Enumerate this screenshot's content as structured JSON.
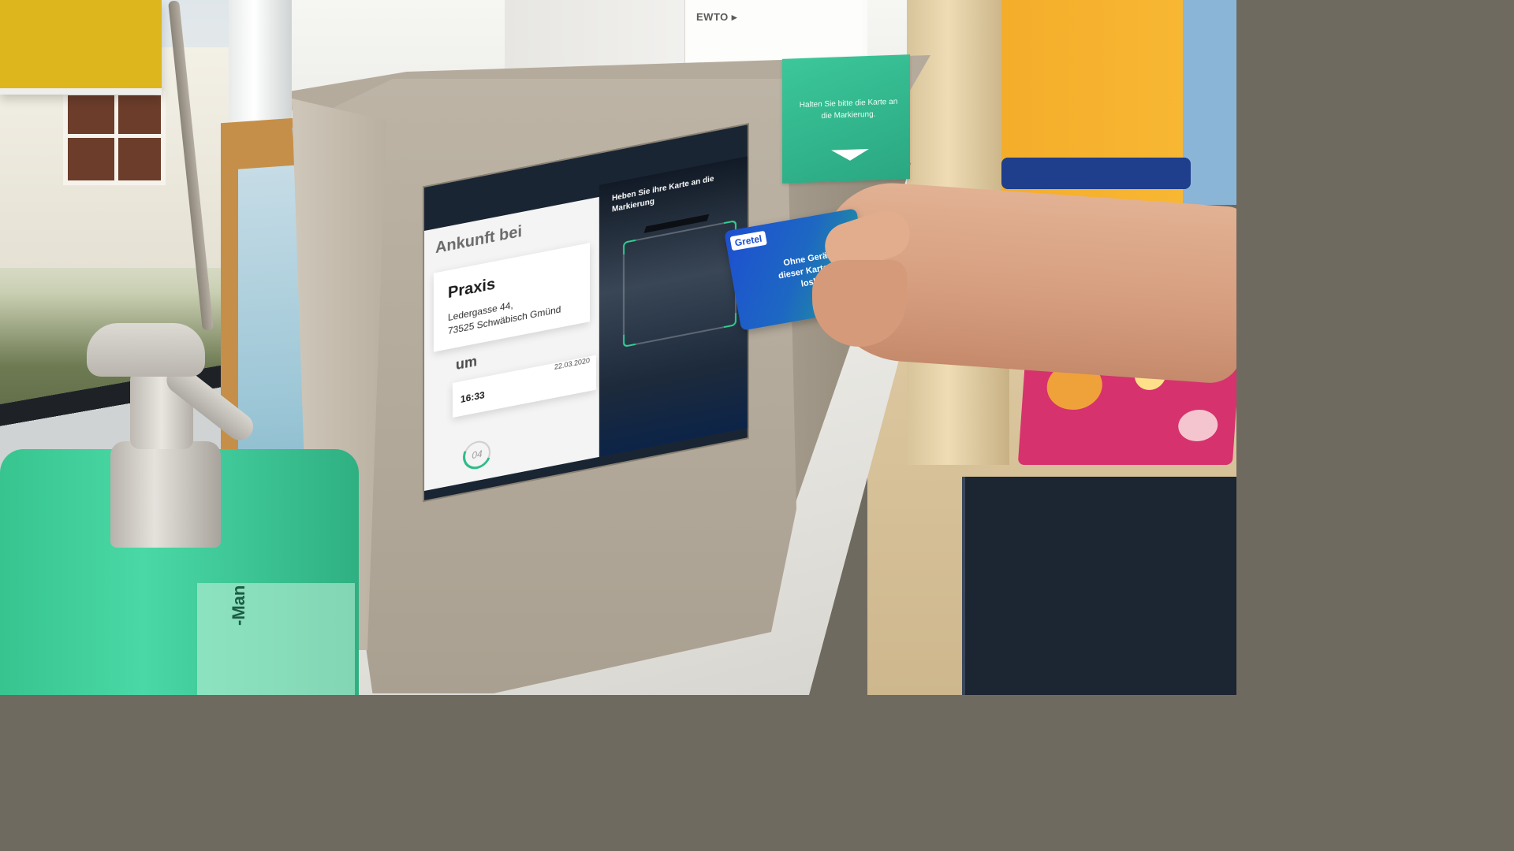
{
  "box_flap": {
    "instruction": "Halten Sie bitte die Karte an die Markierung."
  },
  "paper": {
    "ewto_label": "EWTO ▸"
  },
  "screen": {
    "arrival_title": "Ankunft bei",
    "practice": {
      "name": "Praxis",
      "address_line1": "Ledergasse 44,",
      "address_line2": "73525 Schwäbisch Gmünd"
    },
    "time_label": "um",
    "time": "16:33",
    "date": "22.03.2020",
    "countdown": "04",
    "scan_instruction": "Heben Sie ihre Karte an die Markierung"
  },
  "card": {
    "brand": "Gretel",
    "text": "Ohne Gerät mit dieser Karte sofort loslegen"
  },
  "soap": {
    "brand_fragment": "-Man"
  },
  "colors": {
    "accent_green": "#2dbb88",
    "card_blue": "#1d4fd1",
    "flap_green": "#3cc79a"
  }
}
